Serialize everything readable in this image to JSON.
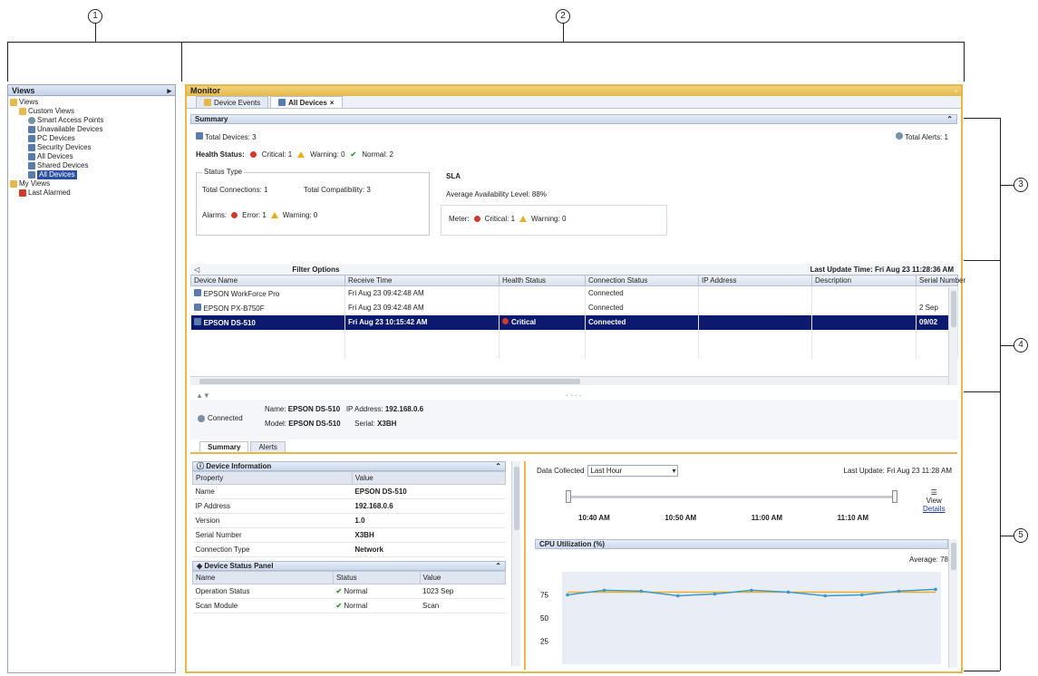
{
  "callouts": [
    "1",
    "2",
    "3",
    "4",
    "5"
  ],
  "nav": {
    "header": "Views",
    "items": [
      {
        "label": "Views",
        "icon": "folder-icon",
        "indent": 0
      },
      {
        "label": "Custom Views",
        "icon": "folder-icon",
        "indent": 1
      },
      {
        "label": "Smart Access Points",
        "icon": "user-icon",
        "indent": 2
      },
      {
        "label": "Unavailable Devices",
        "icon": "device-icon",
        "indent": 2
      },
      {
        "label": "PC Devices",
        "icon": "device-icon",
        "indent": 2
      },
      {
        "label": "Security Devices",
        "icon": "device-icon",
        "indent": 2
      },
      {
        "label": "All Devices",
        "icon": "device-icon",
        "indent": 2
      },
      {
        "label": "Shared Devices",
        "icon": "device-icon",
        "indent": 2
      },
      {
        "label": "All Devices",
        "icon": "device-icon",
        "indent": 2,
        "selected": true
      },
      {
        "label": "My Views",
        "icon": "folder-icon",
        "indent": 0
      },
      {
        "label": "Last Alarmed",
        "icon": "error-icon",
        "indent": 1
      }
    ]
  },
  "main": {
    "title": "Monitor",
    "tabs": [
      {
        "label": "Device Events"
      },
      {
        "label": "All Devices",
        "active": true
      }
    ],
    "summary": {
      "title": "Summary",
      "total_devices": "Total Devices: 3",
      "total_alerts": "Total Alerts: 1",
      "health_label": "Health Status:",
      "critical": "Critical: 1",
      "warning": "Warning: 0",
      "normal": "Normal: 2",
      "group_caption": "Status Type",
      "conn": "Total Connections: 1",
      "compat": "Total Compatibility: 3",
      "alarms": "Alarms:",
      "alarm_err": "Error: 1",
      "alarm_warn": "Warning: 0",
      "sla_title": "SLA",
      "sla_avg": "Average Availability Level: 88%",
      "meter": "Meter:",
      "meter_critical": "Critical: 1",
      "meter_warning": "Warning: 0"
    },
    "table": {
      "filter_label": "Filter Options",
      "last_update": "Last Update Time: Fri Aug 23 11:28:36 AM",
      "columns": [
        "Device Name",
        "Receive Time",
        "Health Status",
        "Connection Status",
        "IP Address",
        "Description",
        "Serial Number"
      ],
      "rows": [
        {
          "name": "EPSON WorkForce Pro",
          "time": "Fri Aug 23 09:42:48 AM",
          "health": "",
          "conn": "Connected",
          "ip": "",
          "desc": "",
          "serial": ""
        },
        {
          "name": "EPSON PX-B750F",
          "time": "Fri Aug 23 09:42:48 AM",
          "health": "",
          "conn": "Connected",
          "ip": "",
          "desc": "",
          "serial": "2 Sep"
        },
        {
          "name": "EPSON DS-510",
          "time": "Fri Aug 23 10:15:42 AM",
          "health": "Critical",
          "conn": "Connected",
          "ip": "",
          "desc": "",
          "serial": "09/02",
          "selected": true
        }
      ]
    },
    "detail": {
      "status": "Connected",
      "name_label": "Name:",
      "name_value": "EPSON DS-510",
      "ip_label": "IP Address:",
      "ip_value": "192.168.0.6",
      "model_label": "Model:",
      "model_value": "EPSON DS-510",
      "serial_label": "Serial:",
      "serial_value": "X3BH",
      "tabs": [
        {
          "label": "Summary",
          "active": true
        },
        {
          "label": "Alerts"
        }
      ],
      "device_info_title": "Device Information",
      "prop_cols": [
        "Property",
        "Value"
      ],
      "props": [
        {
          "k": "Name",
          "v": "EPSON DS-510"
        },
        {
          "k": "IP Address",
          "v": "192.168.0.6"
        },
        {
          "k": "Version",
          "v": "1.0"
        },
        {
          "k": "Serial Number",
          "v": "X3BH"
        },
        {
          "k": "Connection Type",
          "v": "Network"
        }
      ],
      "device_status_title": "Device Status Panel",
      "status_cols": [
        "Name",
        "Status",
        "Value"
      ],
      "status_rows": [
        {
          "k": "Operation Status",
          "s": "Normal",
          "v": "1023 Sep"
        },
        {
          "k": "Scan Module",
          "s": "Normal",
          "v": "Scan"
        }
      ],
      "chart_range_label": "Data Collected",
      "chart_range_value": "Last Hour",
      "chart_settings": "Last Update: Fri Aug 23 11:28 AM",
      "view_details_line1": "View",
      "view_details_line2": "Details",
      "chart_title": "CPU Utilization (%)",
      "chart_avg": "Average: 78",
      "timeline_labels": [
        "10:40 AM",
        "10:50 AM",
        "11:00 AM",
        "11:10 AM"
      ]
    }
  },
  "chart_data": {
    "type": "line",
    "title": "CPU Utilization (%)",
    "xlabel": "",
    "ylabel": "",
    "y_tick_labels": [
      "75",
      "50",
      "25"
    ],
    "ylim": [
      0,
      100
    ],
    "series": [
      {
        "name": "Average",
        "values": [
          78,
          78,
          78,
          78,
          78,
          78,
          78,
          78,
          78,
          78,
          78
        ]
      },
      {
        "values": [
          75,
          80,
          79,
          74,
          76,
          80,
          78,
          74,
          75,
          79,
          81
        ]
      }
    ]
  },
  "colors": {
    "accent": "#e4b94c",
    "selected_row": "#0b1a6e",
    "critical": "#d23a2a",
    "warning": "#e8b020",
    "normal": "#2a9a2a"
  }
}
